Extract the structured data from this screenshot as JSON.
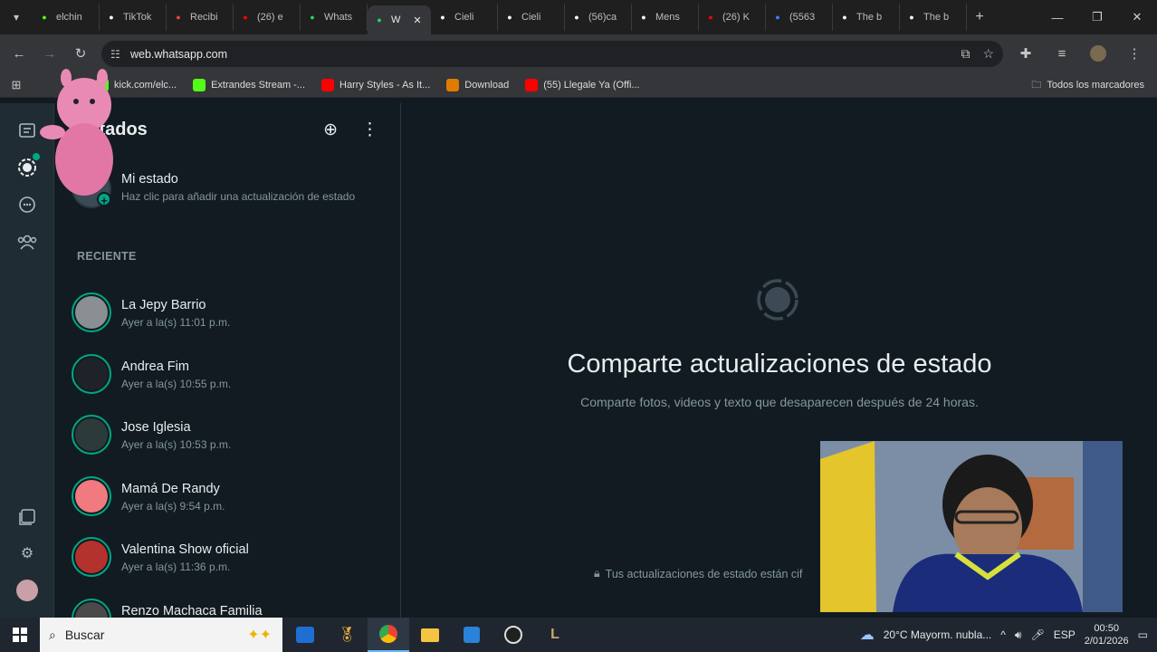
{
  "browser": {
    "tabs": [
      {
        "label": "elchin",
        "icon": "kick-icon",
        "color": "#53fc18"
      },
      {
        "label": "TikTok",
        "icon": "tiktok-icon",
        "color": "#ffffff"
      },
      {
        "label": "Recibi",
        "icon": "gmail-icon",
        "color": "#ea4335"
      },
      {
        "label": "(26) e",
        "icon": "youtube-icon",
        "color": "#ff0000"
      },
      {
        "label": "Whats",
        "icon": "whatsapp-icon",
        "color": "#25d366"
      },
      {
        "label": "W",
        "icon": "whatsapp-icon",
        "color": "#25d366",
        "active": true
      },
      {
        "label": "Cieli",
        "icon": "tiktok-icon",
        "color": "#ffffff"
      },
      {
        "label": "Cieli",
        "icon": "tiktok-icon",
        "color": "#ffffff"
      },
      {
        "label": "(56)ca",
        "icon": "tiktok-icon",
        "color": "#ffffff"
      },
      {
        "label": "Mens",
        "icon": "tiktok-icon",
        "color": "#ffffff"
      },
      {
        "label": "(26) K",
        "icon": "youtube-icon",
        "color": "#ff0000"
      },
      {
        "label": "(5563",
        "icon": "skype-icon",
        "color": "#3b82f6"
      },
      {
        "label": "The b",
        "icon": "diamond-icon",
        "color": "#ffffff"
      },
      {
        "label": "The b",
        "icon": "diamond-icon",
        "color": "#ffffff"
      }
    ],
    "url": "web.whatsapp.com",
    "bookmarks": [
      {
        "label": "kick.com/elc...",
        "icon": "kick-icon",
        "color": "#53fc18"
      },
      {
        "label": "Extrandes Stream -...",
        "icon": "kick-icon",
        "color": "#53fc18"
      },
      {
        "label": "Harry Styles - As It...",
        "icon": "youtube-icon",
        "color": "#ff0000"
      },
      {
        "label": "Download",
        "icon": "r-icon",
        "color": "#e07b00"
      },
      {
        "label": "(55) Llegale Ya (Offi...",
        "icon": "youtube-icon",
        "color": "#ff0000"
      }
    ],
    "all_bookmarks": "Todos los marcadores"
  },
  "whatsapp": {
    "panel_title": "Estados",
    "my_status": {
      "name": "Mi estado",
      "hint": "Haz clic para añadir una actualización de estado"
    },
    "section_recent": "RECIENTE",
    "contacts": [
      {
        "name": "La Jepy Barrio",
        "time": "Ayer a la(s) 11:01 p.m.",
        "avatar_color": "#8a8f94"
      },
      {
        "name": "Andrea Fim",
        "time": "Ayer a la(s) 10:55 p.m.",
        "avatar_color": "#1d2328"
      },
      {
        "name": "Jose Iglesia",
        "time": "Ayer a la(s) 10:53 p.m.",
        "avatar_color": "#2d3a3a"
      },
      {
        "name": "Mamá De Randy",
        "time": "Ayer a la(s) 9:54 p.m.",
        "avatar_color": "#f07a7f"
      },
      {
        "name": "Valentina Show oficial",
        "time": "Ayer a la(s) 11:36 p.m.",
        "avatar_color": "#b3322e"
      },
      {
        "name": "Renzo Machaca Familia",
        "time": "",
        "avatar_color": "#4a4a4a"
      }
    ],
    "main": {
      "title": "Comparte actualizaciones de estado",
      "subtitle": "Comparte fotos, videos y texto que desaparecen después de 24 horas.",
      "encryption": "Tus actualizaciones de estado están cif"
    }
  },
  "taskbar": {
    "search_placeholder": "Buscar",
    "weather": "20°C  Mayorm. nubla...",
    "language": "ESP",
    "time": "00:50",
    "date": "2/01/2026"
  },
  "colors": {
    "accent": "#00a884",
    "panel_bg": "#111b21",
    "rail_bg": "#202c33"
  }
}
